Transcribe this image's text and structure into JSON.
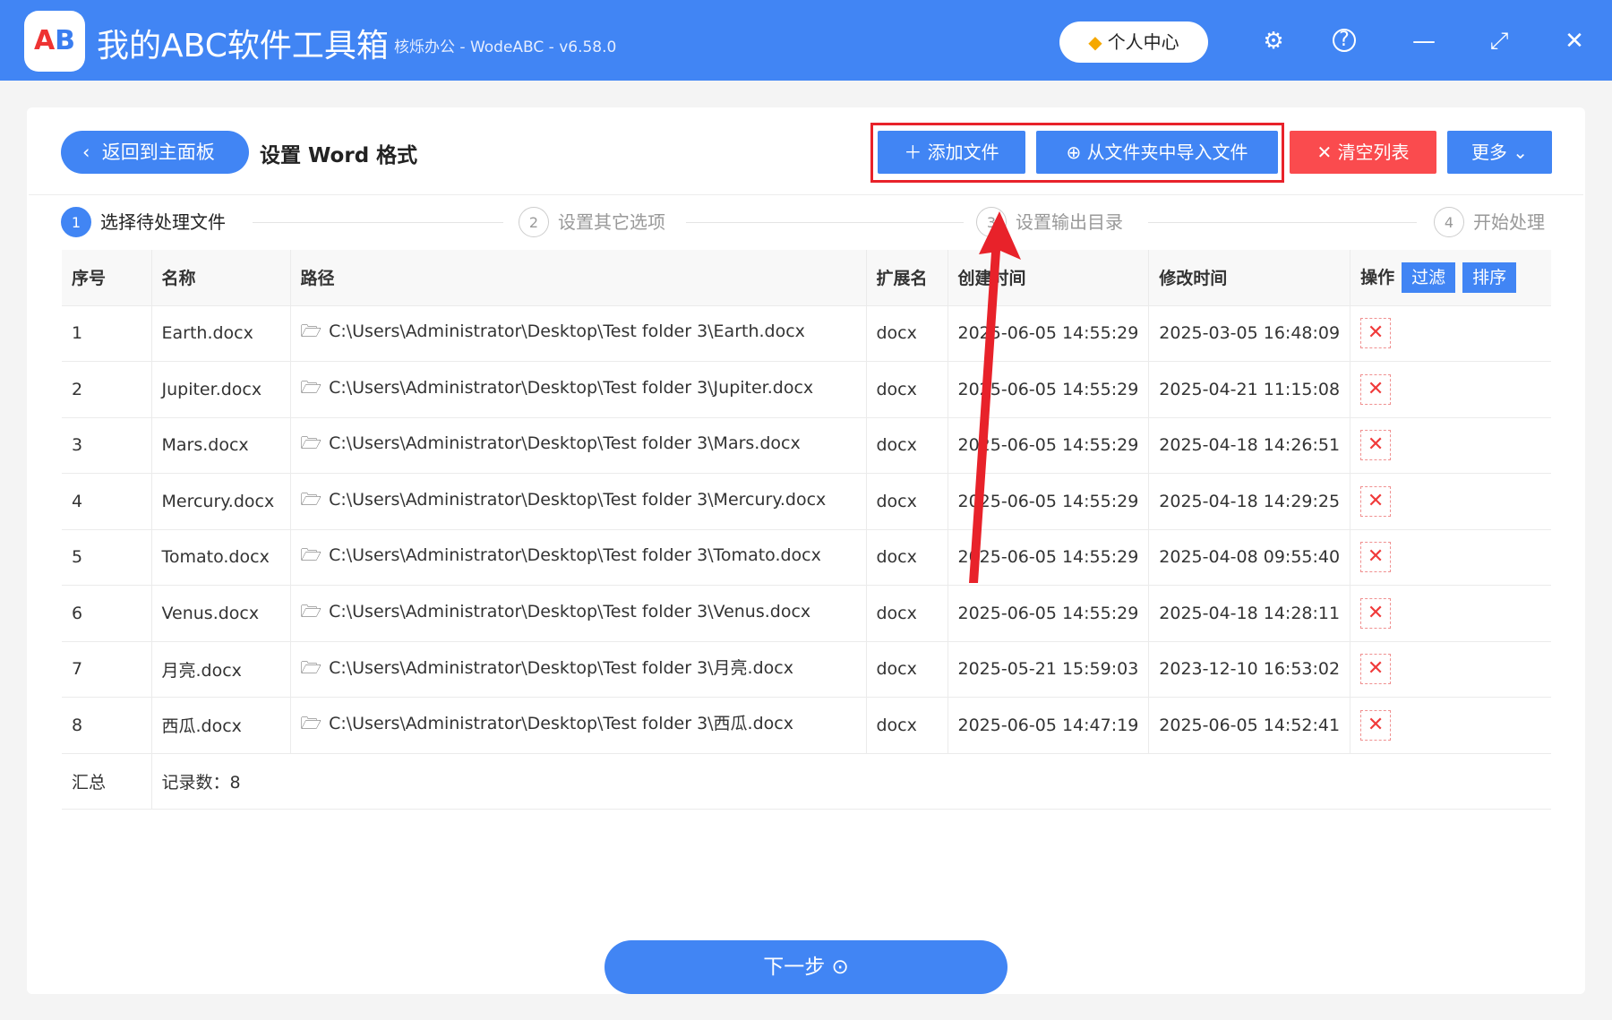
{
  "header": {
    "logo_text": "AB",
    "title": "我的ABC软件工具箱",
    "subtitle": "核烁办公 - WodeABC - v6.58.0",
    "user_center": "个人中心"
  },
  "toolbar": {
    "back": "返回到主面板",
    "page_title": "设置 Word 格式",
    "add_file": "添加文件",
    "import_folder": "从文件夹中导入文件",
    "clear_list": "清空列表",
    "more": "更多"
  },
  "steps": [
    {
      "num": "1",
      "label": "选择待处理文件"
    },
    {
      "num": "2",
      "label": "设置其它选项"
    },
    {
      "num": "3",
      "label": "设置输出目录"
    },
    {
      "num": "4",
      "label": "开始处理"
    }
  ],
  "table": {
    "headers": [
      "序号",
      "名称",
      "路径",
      "扩展名",
      "创建时间",
      "修改时间",
      "操作"
    ],
    "filter": "过滤",
    "sort": "排序",
    "rows": [
      [
        "1",
        "Earth.docx",
        "C:\\Users\\Administrator\\Desktop\\Test folder 3\\Earth.docx",
        "docx",
        "2025-06-05 14:55:29",
        "2025-03-05 16:48:09"
      ],
      [
        "2",
        "Jupiter.docx",
        "C:\\Users\\Administrator\\Desktop\\Test folder 3\\Jupiter.docx",
        "docx",
        "2025-06-05 14:55:29",
        "2025-04-21 11:15:08"
      ],
      [
        "3",
        "Mars.docx",
        "C:\\Users\\Administrator\\Desktop\\Test folder 3\\Mars.docx",
        "docx",
        "2025-06-05 14:55:29",
        "2025-04-18 14:26:51"
      ],
      [
        "4",
        "Mercury.docx",
        "C:\\Users\\Administrator\\Desktop\\Test folder 3\\Mercury.docx",
        "docx",
        "2025-06-05 14:55:29",
        "2025-04-18 14:29:25"
      ],
      [
        "5",
        "Tomato.docx",
        "C:\\Users\\Administrator\\Desktop\\Test folder 3\\Tomato.docx",
        "docx",
        "2025-06-05 14:55:29",
        "2025-04-08 09:55:40"
      ],
      [
        "6",
        "Venus.docx",
        "C:\\Users\\Administrator\\Desktop\\Test folder 3\\Venus.docx",
        "docx",
        "2025-06-05 14:55:29",
        "2025-04-18 14:28:11"
      ],
      [
        "7",
        "月亮.docx",
        "C:\\Users\\Administrator\\Desktop\\Test folder 3\\月亮.docx",
        "docx",
        "2025-05-21 15:59:03",
        "2023-12-10 16:53:02"
      ],
      [
        "8",
        "西瓜.docx",
        "C:\\Users\\Administrator\\Desktop\\Test folder 3\\西瓜.docx",
        "docx",
        "2025-06-05 14:47:19",
        "2025-06-05 14:52:41"
      ]
    ],
    "summary_label": "汇总",
    "summary_value": "记录数：8"
  },
  "next_button": "下一步"
}
